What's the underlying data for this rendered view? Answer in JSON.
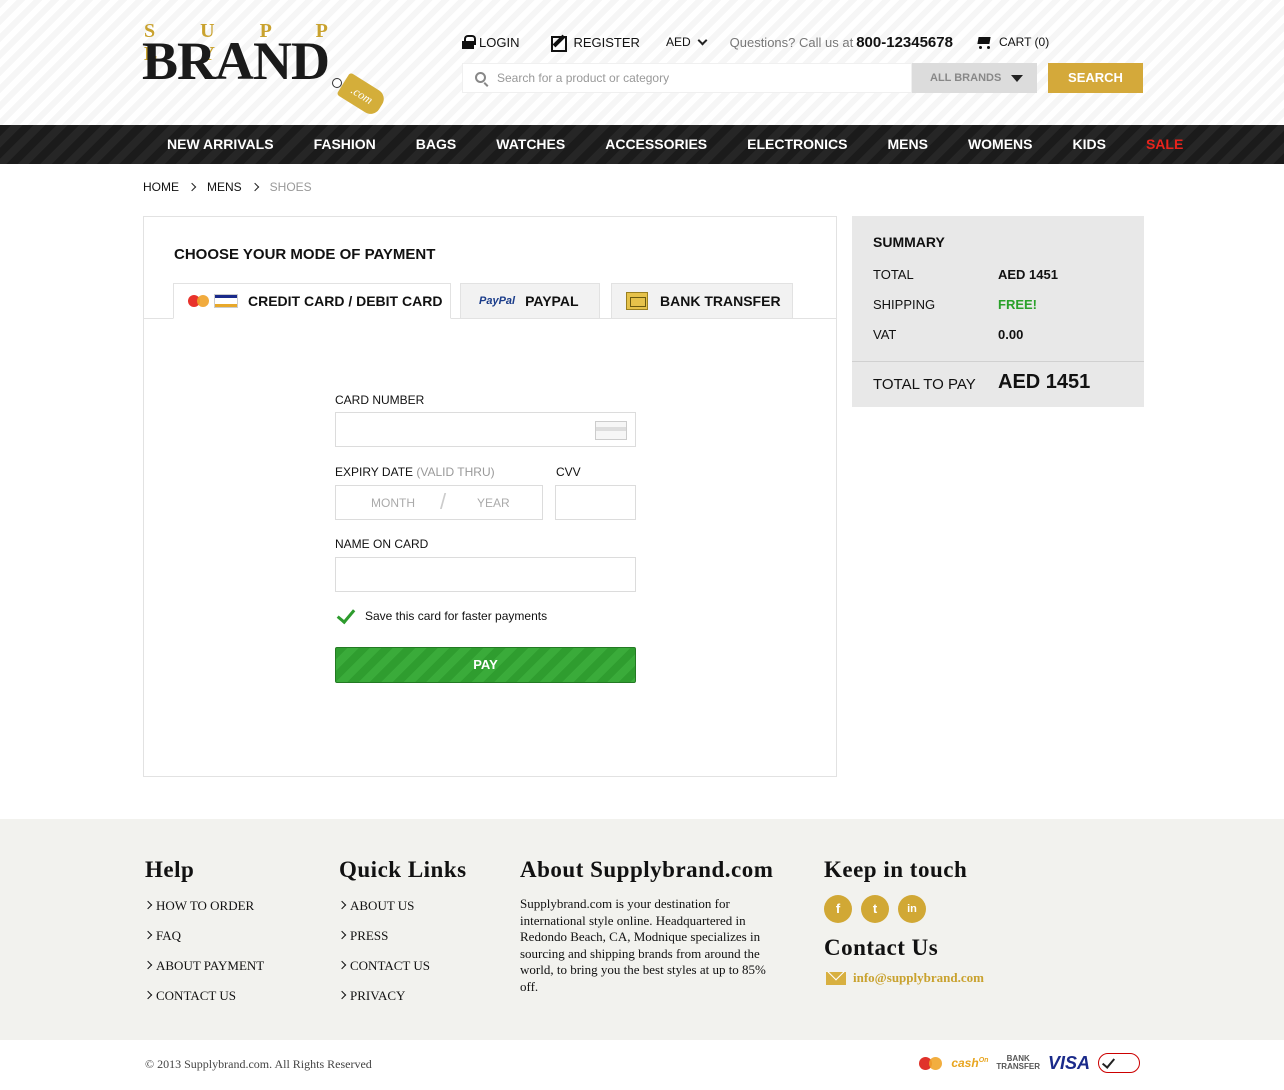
{
  "logo": {
    "top": "S U P P L Y",
    "main": "BRAND",
    "tag": ".com"
  },
  "header": {
    "login": "LOGIN",
    "register": "REGISTER",
    "currency": "AED",
    "questions": "Questions? Call us at",
    "phone": "800-12345678",
    "cart": "CART (0)",
    "search_placeholder": "Search for a product or category",
    "brands": "ALL BRANDS",
    "search_button": "SEARCH"
  },
  "nav": [
    "NEW ARRIVALS",
    "FASHION",
    "BAGS",
    "WATCHES",
    "ACCESSORIES",
    "ELECTRONICS",
    "MENS",
    "WOMENS",
    "KIDS",
    "SALE"
  ],
  "breadcrumb": [
    "HOME",
    "MENS",
    "SHOES"
  ],
  "payment": {
    "title": "CHOOSE YOUR MODE OF PAYMENT",
    "tabs": [
      {
        "label": "CREDIT CARD / DEBIT CARD",
        "active": true
      },
      {
        "label": "PAYPAL",
        "active": false,
        "logo": "PayPal"
      },
      {
        "label": "BANK TRANSFER",
        "active": false
      }
    ],
    "card_number_label": "CARD NUMBER",
    "expiry_label": "EXPIRY DATE",
    "expiry_hint": "(VALID THRU)",
    "month_placeholder": "MONTH",
    "year_placeholder": "YEAR",
    "cvv_label": "CVV",
    "name_label": "NAME ON CARD",
    "save_card": "Save this card for faster payments",
    "save_card_checked": true,
    "pay_button": "PAY"
  },
  "summary": {
    "title": "SUMMARY",
    "rows": [
      {
        "label": "TOTAL",
        "value": "AED 1451"
      },
      {
        "label": "SHIPPING",
        "value": "FREE!"
      },
      {
        "label": "VAT",
        "value": "0.00"
      }
    ],
    "total_label": "TOTAL TO PAY",
    "total_value": "AED 1451"
  },
  "footer": {
    "help_title": "Help",
    "help_links": [
      "HOW TO ORDER",
      "FAQ",
      "ABOUT PAYMENT",
      "CONTACT US"
    ],
    "quick_title": "Quick Links",
    "quick_links": [
      "ABOUT US",
      "PRESS",
      "CONTACT US",
      "PRIVACY"
    ],
    "about_title": "About Supplybrand.com",
    "about_text": "Supplybrand.com is your destination for international style online. Headquartered in Redondo Beach, CA, Modnique specializes in sourcing and shipping brands from around the world, to bring you the best styles at up to 85% off.",
    "keep_title": "Keep in touch",
    "social": [
      "f",
      "t",
      "in"
    ],
    "contact_title": "Contact Us",
    "email": "info@supplybrand.com",
    "copyright": "© 2013 Supplybrand.com. All Rights Reserved",
    "payment_logos": {
      "cash": "cash",
      "cash_sup": "On",
      "bank_line1": "BANK",
      "bank_line2": "TRANSFER",
      "visa": "VISA"
    }
  },
  "colors": {
    "accent": "#d4a93a",
    "nav_bg": "#1b1b1b",
    "sale": "#e8231c",
    "pay_green": "#2f9d2f",
    "free_green": "#2aa12a"
  }
}
